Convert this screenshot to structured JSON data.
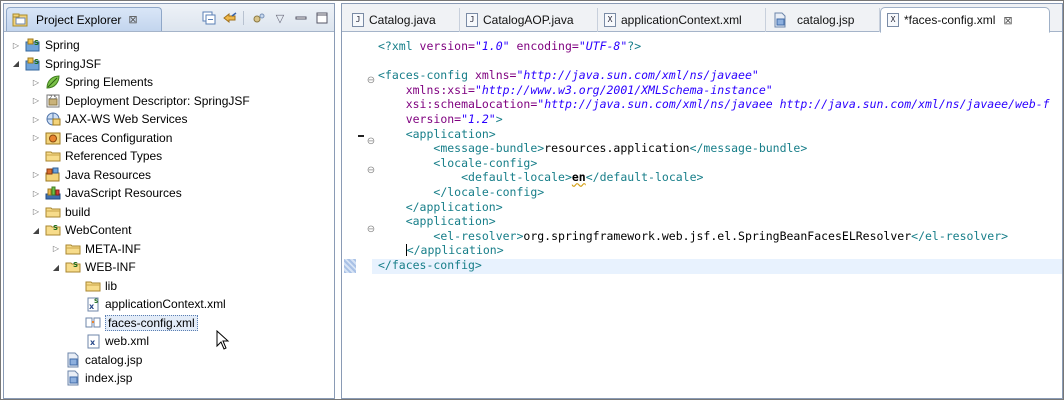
{
  "explorer": {
    "tab_label": "Project Explorer",
    "tab_close": "⊠",
    "items": [
      {
        "label": "Spring",
        "depth": 0,
        "expanded": false,
        "icon": "spring-project-icon"
      },
      {
        "label": "SpringJSF",
        "depth": 0,
        "expanded": true,
        "icon": "spring-project-icon"
      },
      {
        "label": "Spring Elements",
        "depth": 1,
        "expanded": false,
        "icon": "spring-elements-icon"
      },
      {
        "label": "Deployment Descriptor: SpringJSF",
        "depth": 1,
        "expanded": false,
        "icon": "deployment-descriptor-icon"
      },
      {
        "label": "JAX-WS Web Services",
        "depth": 1,
        "expanded": false,
        "icon": "web-services-icon"
      },
      {
        "label": "Faces Configuration",
        "depth": 1,
        "expanded": false,
        "icon": "faces-config-icon"
      },
      {
        "label": "Referenced Types",
        "depth": 1,
        "expanded": null,
        "icon": "folder-icon"
      },
      {
        "label": "Java Resources",
        "depth": 1,
        "expanded": false,
        "icon": "java-resources-icon"
      },
      {
        "label": "JavaScript Resources",
        "depth": 1,
        "expanded": false,
        "icon": "javascript-resources-icon"
      },
      {
        "label": "build",
        "depth": 1,
        "expanded": false,
        "icon": "folder-icon"
      },
      {
        "label": "WebContent",
        "depth": 1,
        "expanded": true,
        "icon": "spring-folder-icon"
      },
      {
        "label": "META-INF",
        "depth": 2,
        "expanded": false,
        "icon": "folder-icon"
      },
      {
        "label": "WEB-INF",
        "depth": 2,
        "expanded": true,
        "icon": "spring-folder-icon"
      },
      {
        "label": "lib",
        "depth": 3,
        "expanded": null,
        "icon": "folder-icon"
      },
      {
        "label": "applicationContext.xml",
        "depth": 3,
        "expanded": null,
        "icon": "spring-xml-file-icon"
      },
      {
        "label": "faces-config.xml",
        "depth": 3,
        "expanded": null,
        "icon": "faces-xml-file-icon",
        "selected": true
      },
      {
        "label": "web.xml",
        "depth": 3,
        "expanded": null,
        "icon": "xml-file-icon"
      },
      {
        "label": "catalog.jsp",
        "depth": 2,
        "expanded": null,
        "icon": "jsp-file-icon"
      },
      {
        "label": "index.jsp",
        "depth": 2,
        "expanded": null,
        "icon": "jsp-file-icon"
      }
    ]
  },
  "editor": {
    "tabs": [
      {
        "label": "Catalog.java",
        "type": "J"
      },
      {
        "label": "CatalogAOP.java",
        "type": "J"
      },
      {
        "label": "applicationContext.xml",
        "type": "X"
      },
      {
        "label": "catalog.jsp",
        "type": "jsp"
      },
      {
        "label": "*faces-config.xml",
        "type": "X",
        "active": true
      }
    ],
    "active_close": "⊠"
  },
  "code": {
    "l1_pi": "<?xml ",
    "l1_a1": "version=",
    "l1_v1": "\"1.0\"",
    "l1_a2": " encoding=",
    "l1_v2": "\"UTF-8\"",
    "l1_end": "?>",
    "l3_tag": "<faces-config ",
    "l3_attr": "xmlns=",
    "l3_val": "\"http://java.sun.com/xml/ns/javaee\"",
    "l4_attr": "xmlns:xsi=",
    "l4_val": "\"http://www.w3.org/2001/XMLSchema-instance\"",
    "l5_attr": "xsi:schemaLocation=",
    "l5_val": "\"http://java.sun.com/xml/ns/javaee http://java.sun.com/xml/ns/javaee/web-f",
    "l6_attr": "version=",
    "l6_val": "\"1.2\"",
    "l6_end": ">",
    "l7": "<application>",
    "l8_open": "<message-bundle>",
    "l8_text": "resources.application",
    "l8_close": "</message-bundle>",
    "l9": "<locale-config>",
    "l10_open": "<default-locale>",
    "l10_text": "en",
    "l10_close": "</default-locale>",
    "l11": "</locale-config>",
    "l12": "</application>",
    "l13": "<application>",
    "l14_open": "<el-resolver>",
    "l14_text": "org.springframework.web.jsf.el.SpringBeanFacesELResolver",
    "l14_close": "</el-resolver>",
    "l15": "</application>",
    "l16": "</faces-config>"
  }
}
